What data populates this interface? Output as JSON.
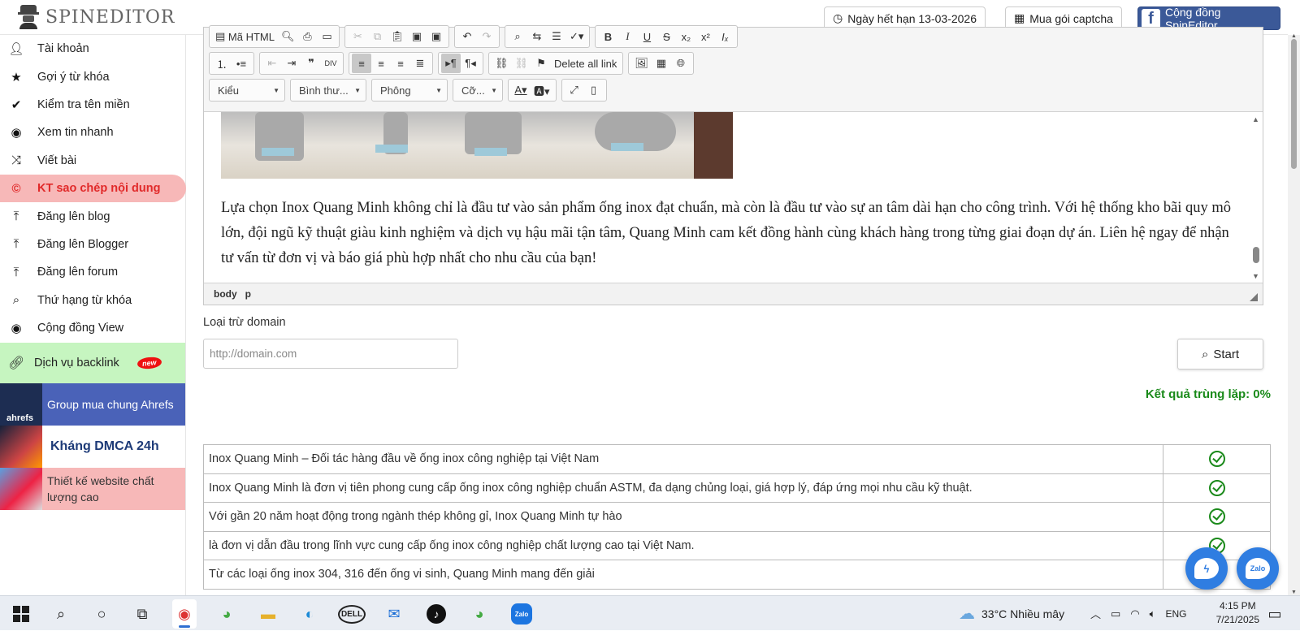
{
  "header": {
    "brand": "SPINEDITOR",
    "expiry": "Ngày hết hạn 13-03-2026",
    "captcha": "Mua gói captcha",
    "community": "Cộng đồng SpinEditor"
  },
  "sidebar": {
    "items": [
      {
        "label": "Tài khoản",
        "icon": "user-icon"
      },
      {
        "label": "Gợi ý từ khóa",
        "icon": "star-icon"
      },
      {
        "label": "Kiểm tra tên miền",
        "icon": "check-icon"
      },
      {
        "label": "Xem tin nhanh",
        "icon": "eye-icon"
      },
      {
        "label": "Viết bài",
        "icon": "shuffle-icon"
      },
      {
        "label": "KT sao chép nội dung",
        "icon": "copyright-icon",
        "active": true
      },
      {
        "label": "Đăng lên blog",
        "icon": "upload-icon"
      },
      {
        "label": "Đăng lên Blogger",
        "icon": "upload-icon"
      },
      {
        "label": "Đăng lên forum",
        "icon": "upload-icon"
      },
      {
        "label": "Thứ hạng từ khóa",
        "icon": "search-icon"
      },
      {
        "label": "Cộng đồng View",
        "icon": "eye-icon"
      }
    ],
    "backlink": {
      "label": "Dịch vụ backlink",
      "badge": "new"
    },
    "promos": {
      "ahrefs": {
        "thumb_text": "ahrefs",
        "label": "Group mua chung Ahrefs"
      },
      "dmca": {
        "label": "Kháng DMCA 24h"
      },
      "web": {
        "label": "Thiết kế website chất lượng cao"
      }
    }
  },
  "editor": {
    "toolbar": {
      "source": "Mã HTML",
      "delete_links": "Delete all link",
      "styles": "Kiểu",
      "format": "Bình thư...",
      "font": "Phông",
      "size": "Cỡ..."
    },
    "paragraph": "Lựa chọn Inox Quang Minh không chỉ là đầu tư vào sản phẩm ống inox đạt chuẩn, mà còn là đầu tư vào sự an tâm dài hạn cho công trình. Với hệ thống kho bãi quy mô lớn, đội ngũ kỹ thuật giàu kinh nghiệm và dịch vụ hậu mãi tận tâm, Quang Minh cam kết đồng hành cùng khách hàng trong từng giai đoạn dự án. Liên hệ ngay để nhận tư vấn từ đơn vị và báo giá phù hợp nhất cho nhu cầu của bạn!",
    "path": [
      "body",
      "p"
    ]
  },
  "exclude": {
    "label": "Loại trừ domain",
    "placeholder": "http://domain.com",
    "start": "Start"
  },
  "result": "Kết quả trùng lặp: 0%",
  "rows": [
    "Inox Quang Minh – Đối tác hàng đầu về ống inox công nghiệp tại Việt Nam",
    "Inox Quang Minh là đơn vị tiên phong cung cấp ống inox công nghiệp chuẩn ASTM, đa dạng chủng loại, giá hợp lý, đáp ứng mọi nhu cầu kỹ thuật.",
    "Với gần 20 năm hoạt động trong ngành thép không gỉ, Inox Quang Minh tự hào",
    "là đơn vị dẫn đầu trong lĩnh vực cung cấp ống inox công nghiệp chất lượng cao tại Việt Nam.",
    "Từ các loại ống inox 304, 316 đến ống vi sinh, Quang Minh mang đến giải"
  ],
  "fabs": {
    "zalo": "Zalo"
  },
  "taskbar": {
    "weather": "33°C  Nhiều mây",
    "lang": "ENG",
    "time": "4:15 PM",
    "date": "7/21/2025"
  },
  "colors": {
    "accent_active": "#e12a2a",
    "success": "#1a8a1a",
    "facebook": "#3b5998"
  }
}
